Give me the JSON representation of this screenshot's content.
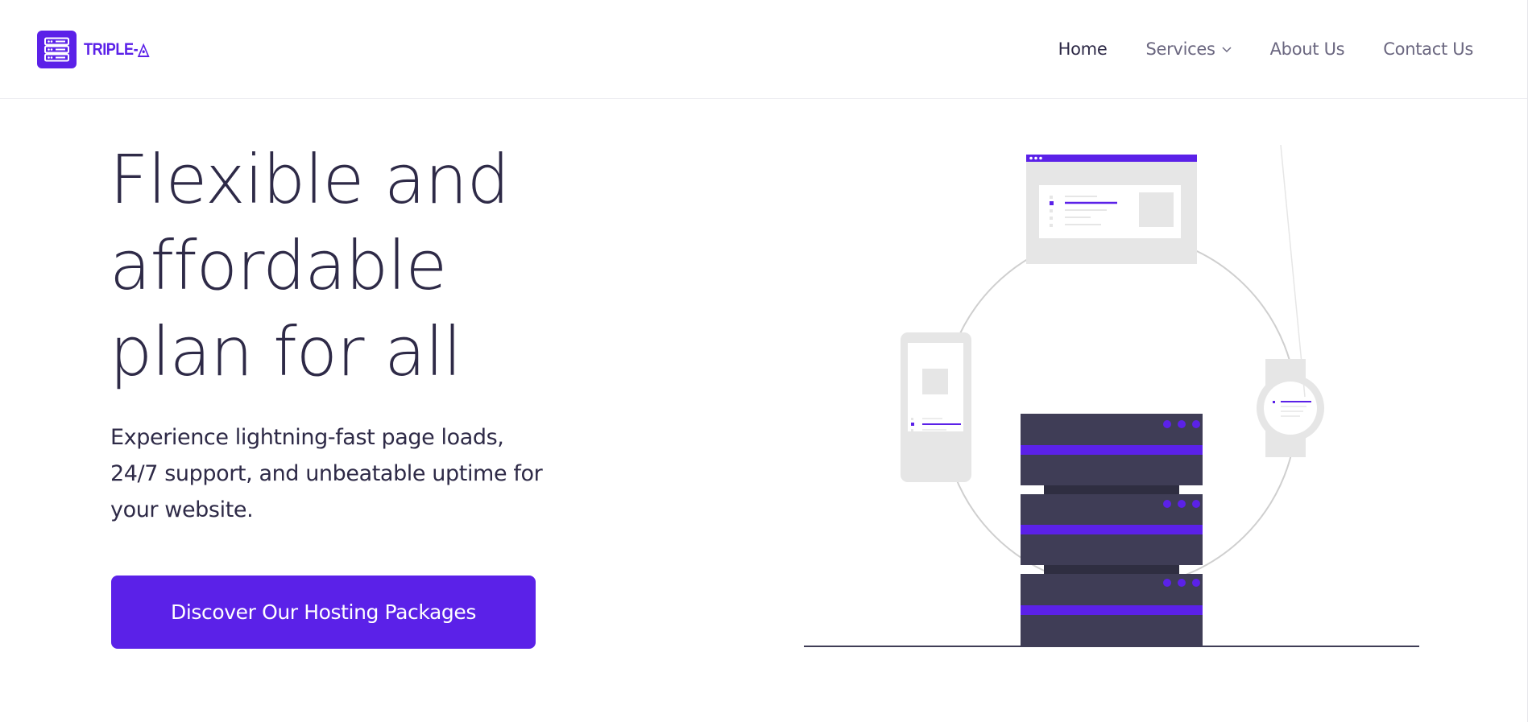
{
  "brand": {
    "name": "TRIPLE-",
    "mark": "◬",
    "icon": "server-logo-icon",
    "color": "#5b21e8"
  },
  "nav": {
    "items": [
      {
        "label": "Home",
        "active": true
      },
      {
        "label": "Services",
        "dropdown": true,
        "icon": "chevron-down-icon"
      },
      {
        "label": "About Us"
      },
      {
        "label": "Contact Us"
      }
    ]
  },
  "hero": {
    "title_lines": [
      "Flexible and",
      "affordable",
      "plan for all"
    ],
    "subtitle_lines": [
      "Experience lightning-fast page loads,",
      "24/7 support, and unbeatable uptime for",
      "your website."
    ],
    "cta_label": "Discover Our Hosting Packages"
  },
  "illustration": {
    "name": "hosting-devices-illustration",
    "colors": {
      "accent": "#5b21e8",
      "server": "#3f3d56",
      "device": "#e6e6e6",
      "ring": "#cfcfcf"
    }
  }
}
